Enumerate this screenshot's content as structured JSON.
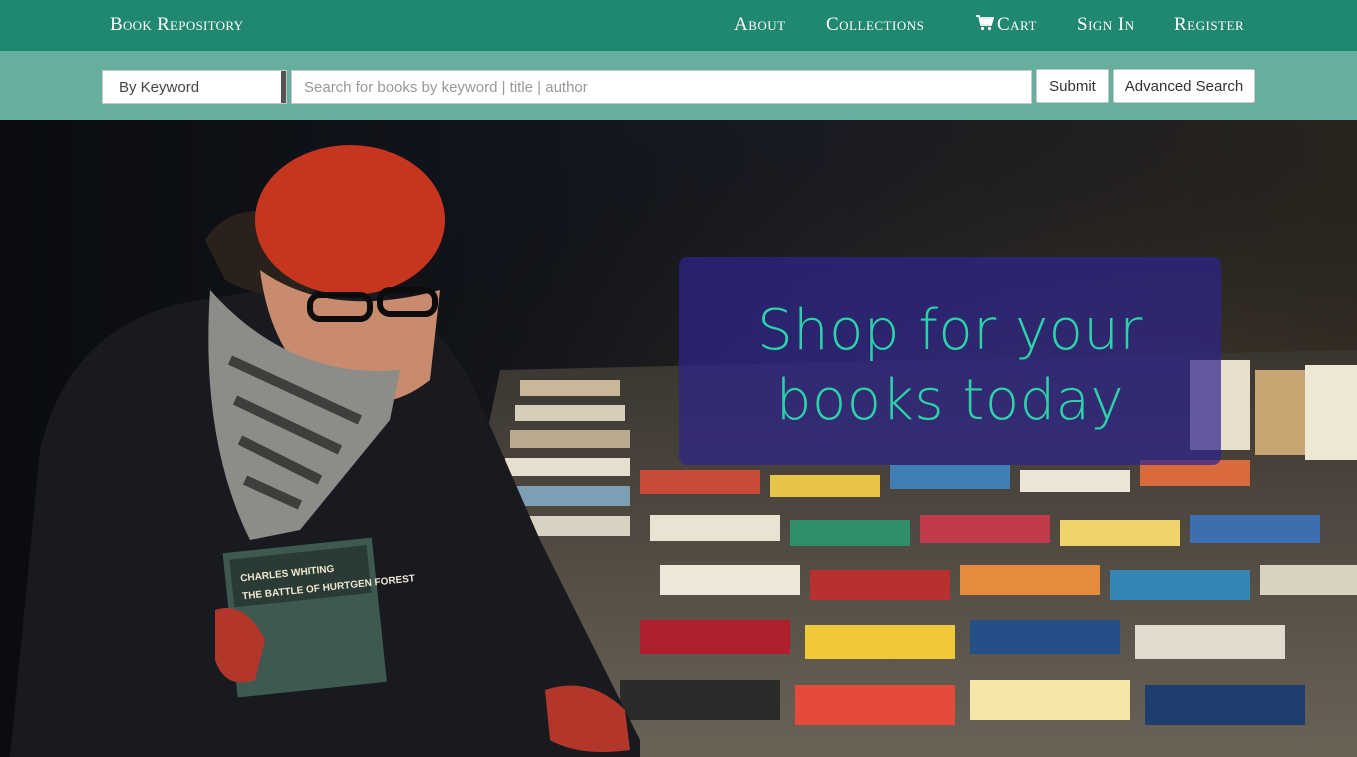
{
  "navbar": {
    "brand": "Book Repository",
    "links": {
      "about": "About",
      "collections": "Collections",
      "cart": "Cart",
      "sign_in": "Sign In",
      "register": "Register"
    },
    "cart_icon": "shopping-cart-icon",
    "background_color": "#208770"
  },
  "search": {
    "type_select": {
      "selected": "By Keyword"
    },
    "input": {
      "value": "",
      "placeholder": "Search for books by keyword | title | author"
    },
    "submit_label": "Submit",
    "advanced_label": "Advanced Search",
    "background_color": "#66af9e"
  },
  "hero": {
    "heading": "Shop for your books today",
    "heading_color": "#2cd3a8",
    "panel_color": "#2e248c",
    "image_description_icon": "person-browsing-books-photo",
    "book_cover_text": [
      "CHARLES WHITING",
      "THE BATTLE OF HURTGEN FOREST"
    ]
  }
}
